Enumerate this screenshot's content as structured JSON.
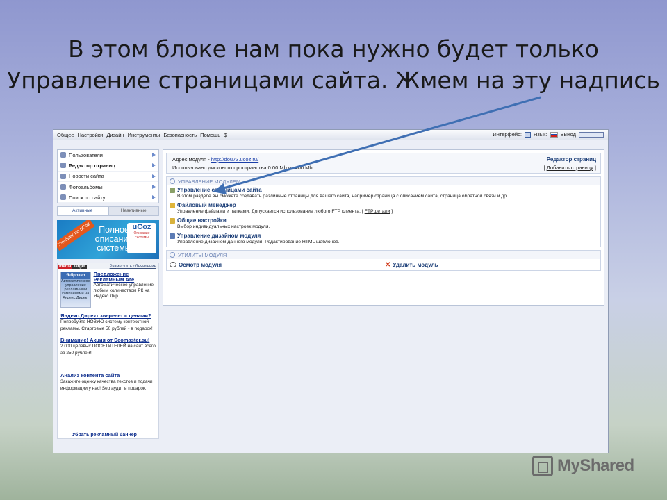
{
  "slide": {
    "title_line1": "В этом блоке нам пока нужно будет только",
    "title_line2": "Управление страницами сайта. Жмем на эту надпись"
  },
  "topbar": {
    "menu": [
      "Общее",
      "Настройки",
      "Дизайн",
      "Инструменты",
      "Безопасность",
      "Помощь",
      "$"
    ],
    "interface_label": "Интерфейс:",
    "language_label": "Язык:",
    "exit_label": "Выход"
  },
  "sidebar": {
    "items": [
      {
        "label": "Пользователи",
        "icon": "users-icon"
      },
      {
        "label": "Редактор страниц",
        "icon": "page-editor-icon"
      },
      {
        "label": "Новости сайта",
        "icon": "news-icon"
      },
      {
        "label": "Фотоальбомы",
        "icon": "photo-icon"
      },
      {
        "label": "Поиск по сайту",
        "icon": "search-icon"
      }
    ],
    "tabs": {
      "active": "Активные",
      "inactive": "Неактивные"
    }
  },
  "banner": {
    "ribbon": "Учебник по uCoz",
    "text": "Полное описание системы",
    "logo": "uCoz",
    "logo_sub": "Описание системы"
  },
  "ads": {
    "brand1": "media",
    "brand2": "target",
    "place_ad": "Разместить объявление",
    "ad1_pic_title": "Я-брокер",
    "ad1_pic_text": "Автоматическое управление рекламными кампаниями на Яндекс.Директ",
    "ad1_title": "Предложение Рекламным Аге",
    "ad1_text": "Автоматическое управление любым количеством РК на Яндекс.Дир",
    "ad2_title": "Яндекс.Директ зверееет с ценами?",
    "ad2_text": "Попробуйте НОВУЮ систему контекстной рекламы. Стартовые 50 рублей - в подарок!",
    "ad3_title": "Внимание! Акция от Seomaster.su!",
    "ad3_text": "2 000 целевых ПОСЕТИТЕЛЕЙ на сайт всего за 250 рублей!!",
    "ad4_title": "Анализ контента сайта",
    "ad4_text": "Закажите оценку качества текстов и подачи информации у нас! Seo аудит в подарок.",
    "remove_banner": "Убрать рекламный баннер"
  },
  "main": {
    "module_address_label": "Адрес модуля -",
    "module_address_link": "http://dou73.ucoz.ru/",
    "disk_usage": "Использовано дискового пространства 0.00 Мb из 400 Mb",
    "panel_title": "Редактор страниц",
    "add_page": "Добавить страницу",
    "section_manage": "УПРАВЛЕНИЕ МОДУЛЕМ",
    "modules": [
      {
        "title": "Управление страницами сайта",
        "desc": "В этом разделе вы сможете создавать различные страницы для вашего сайта, например страница с описанием сайта, страница обратной связи и др.",
        "icon_color": "#8aa069"
      },
      {
        "title": "Файловый менеджер",
        "desc": "Управление файлами и папками. Допускается использование любого FTP клиента.",
        "desc_link": "FTP детали",
        "icon_color": "#e0b53a"
      },
      {
        "title": "Общие настройки",
        "desc": "Выбор индивидуальных настроек модуля.",
        "icon_color": "#d8b23d"
      },
      {
        "title": "Управление дизайном модуля",
        "desc": "Управление дизайном данного модуля. Редактирование HTML шаблонов.",
        "icon_color": "#5b7bb5"
      }
    ],
    "section_utils": "УТИЛИТЫ МОДУЛЯ",
    "util_view": "Осмотр модуля",
    "util_delete": "Удалить модуль"
  },
  "watermark": "MyShared",
  "colors": {
    "arrow": "#3f6fb3",
    "link": "#1a3ea8",
    "heading": "#1d3f78"
  }
}
